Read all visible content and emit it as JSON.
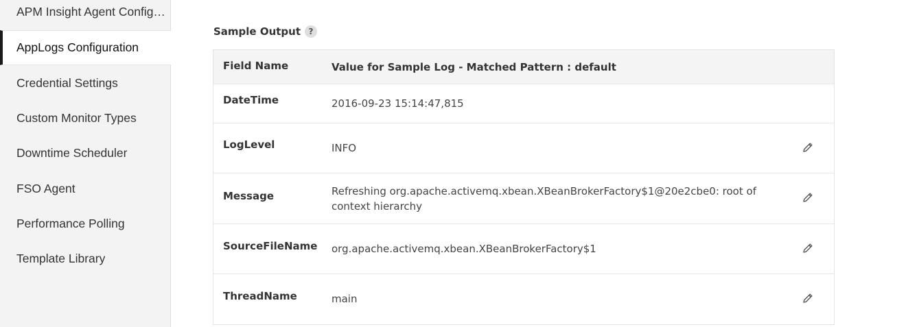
{
  "sidebar": {
    "items": [
      {
        "label": "APM Insight Agent Configuration"
      },
      {
        "label": "AppLogs Configuration"
      },
      {
        "label": "Credential Settings"
      },
      {
        "label": "Custom Monitor Types"
      },
      {
        "label": "Downtime Scheduler"
      },
      {
        "label": "FSO Agent"
      },
      {
        "label": "Performance Polling"
      },
      {
        "label": "Template Library"
      }
    ],
    "active_index": 1
  },
  "sample_output": {
    "title": "Sample Output",
    "help_icon": "?",
    "columns": [
      "Field Name",
      "Value for Sample Log - Matched Pattern : default"
    ],
    "rows": [
      {
        "name": "DateTime",
        "value": "2016-09-23 15:14:47,815",
        "editable": false
      },
      {
        "name": "LogLevel",
        "value": "INFO",
        "editable": true
      },
      {
        "name": "Message",
        "value": "Refreshing org.apache.activemq.xbean.XBeanBrokerFactory$1@20e2cbe0: root of context hierarchy",
        "editable": true
      },
      {
        "name": "SourceFileName",
        "value": "org.apache.activemq.xbean.XBeanBrokerFactory$1",
        "editable": true
      },
      {
        "name": "ThreadName",
        "value": "main",
        "editable": true
      }
    ]
  },
  "icons": {
    "help": "question-circle-icon",
    "edit": "pencil-icon"
  },
  "colors": {
    "sidebar_bg": "#f3f3f3",
    "active_indicator": "#1a1a1a",
    "table_header_bg": "#f4f4f4"
  }
}
